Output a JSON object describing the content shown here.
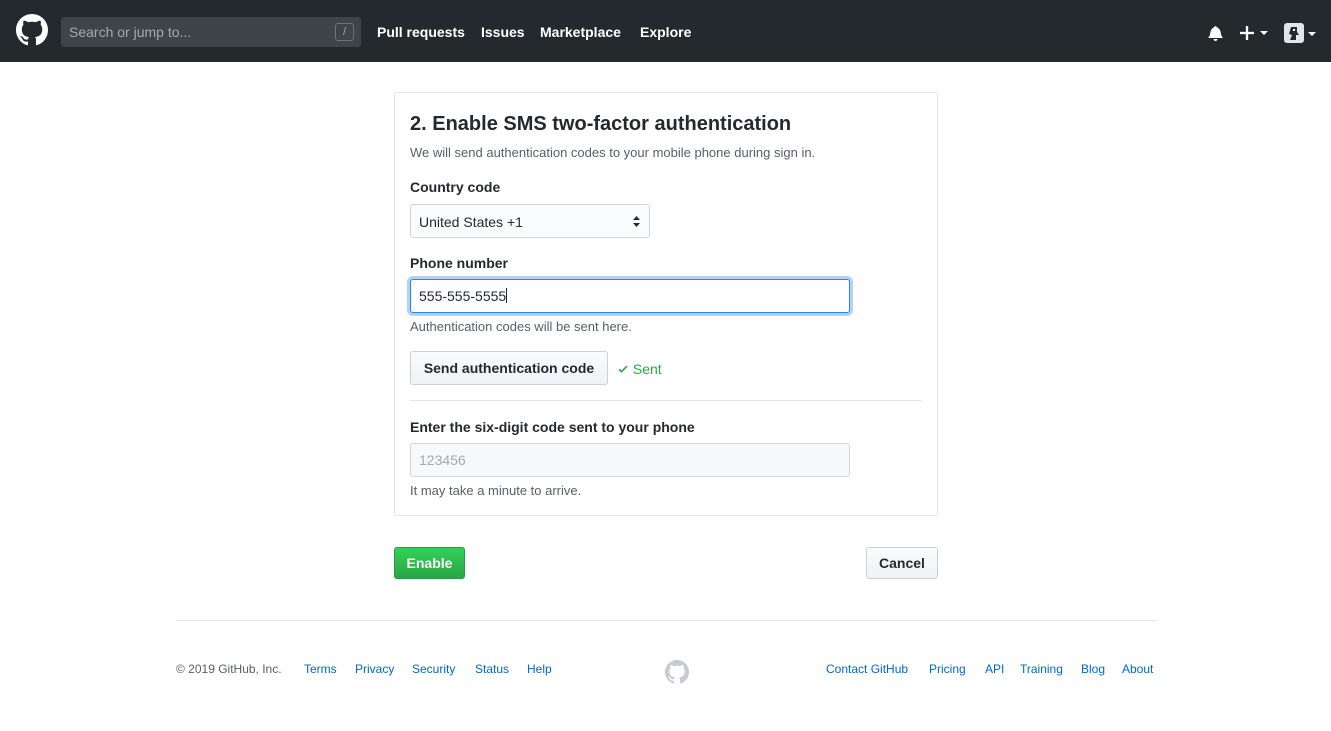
{
  "header": {
    "search_placeholder": "Search or jump to...",
    "search_shortcut": "/",
    "nav": [
      "Pull requests",
      "Issues",
      "Marketplace",
      "Explore"
    ]
  },
  "sms_setup": {
    "title": "2. Enable SMS two-factor authentication",
    "description": "We will send authentication codes to your mobile phone during sign in.",
    "country_label": "Country code",
    "country_value": "United States +1",
    "phone_label": "Phone number",
    "phone_value": "555-555-5555",
    "phone_help": "Authentication codes will be sent here.",
    "send_button": "Send authentication code",
    "sent_status": "Sent",
    "code_label": "Enter the six-digit code sent to your phone",
    "code_placeholder": "123456",
    "code_help": "It may take a minute to arrive."
  },
  "actions": {
    "enable": "Enable",
    "cancel": "Cancel"
  },
  "footer": {
    "copyright": "© 2019 GitHub, Inc.",
    "left_links": [
      "Terms",
      "Privacy",
      "Security",
      "Status",
      "Help"
    ],
    "right_links": [
      "Contact GitHub",
      "Pricing",
      "API",
      "Training",
      "Blog",
      "About"
    ]
  },
  "colors": {
    "header_bg": "#24292e",
    "primary_green": "#28a745",
    "link_blue": "#0366d6",
    "focus_blue": "#2188ff"
  },
  "icons": [
    "github-logo-icon",
    "bell-icon",
    "plus-icon",
    "avatar",
    "select-arrows-icon",
    "check-icon"
  ]
}
